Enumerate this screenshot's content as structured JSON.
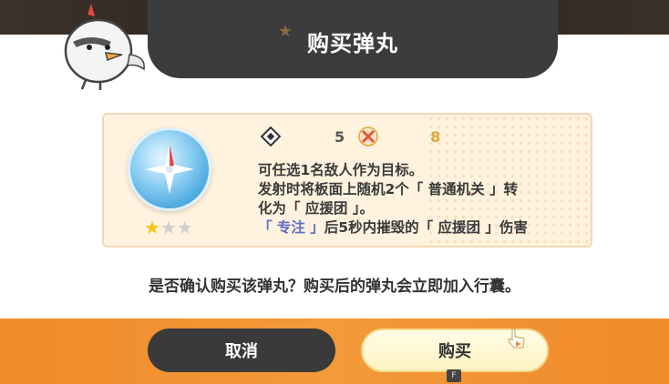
{
  "dialog": {
    "title": "购买弹丸"
  },
  "item": {
    "icon": "blue-shuriken-orb",
    "rarity_stars": 1,
    "rarity_max": 3,
    "stat_a": {
      "icon": "diamond-rune-icon",
      "value": "5"
    },
    "stat_b": {
      "icon": "crossed-arrows-icon",
      "value": "8",
      "color": "#e0a53a"
    },
    "description": {
      "line1": "可任选1名敌人作为目标。",
      "line2": "发射时将板面上随机2个「 普通机关 」转",
      "line3": "化为「 应援团 」。",
      "line4_keyword": "「 专注 」",
      "line4_rest": "后5秒内摧毁的「 应援团 」伤害"
    }
  },
  "confirm_text": "是否确认购买该弹丸？购买后的弹丸会立即加入行囊。",
  "buttons": {
    "cancel_label": "取消",
    "buy_label": "购买",
    "buy_key_hint": "F"
  },
  "colors": {
    "banner": "#3c3c3c",
    "card_bg": "#fff2de",
    "bottom_band": "#f08a2a",
    "keyword": "#5b6cc9"
  }
}
